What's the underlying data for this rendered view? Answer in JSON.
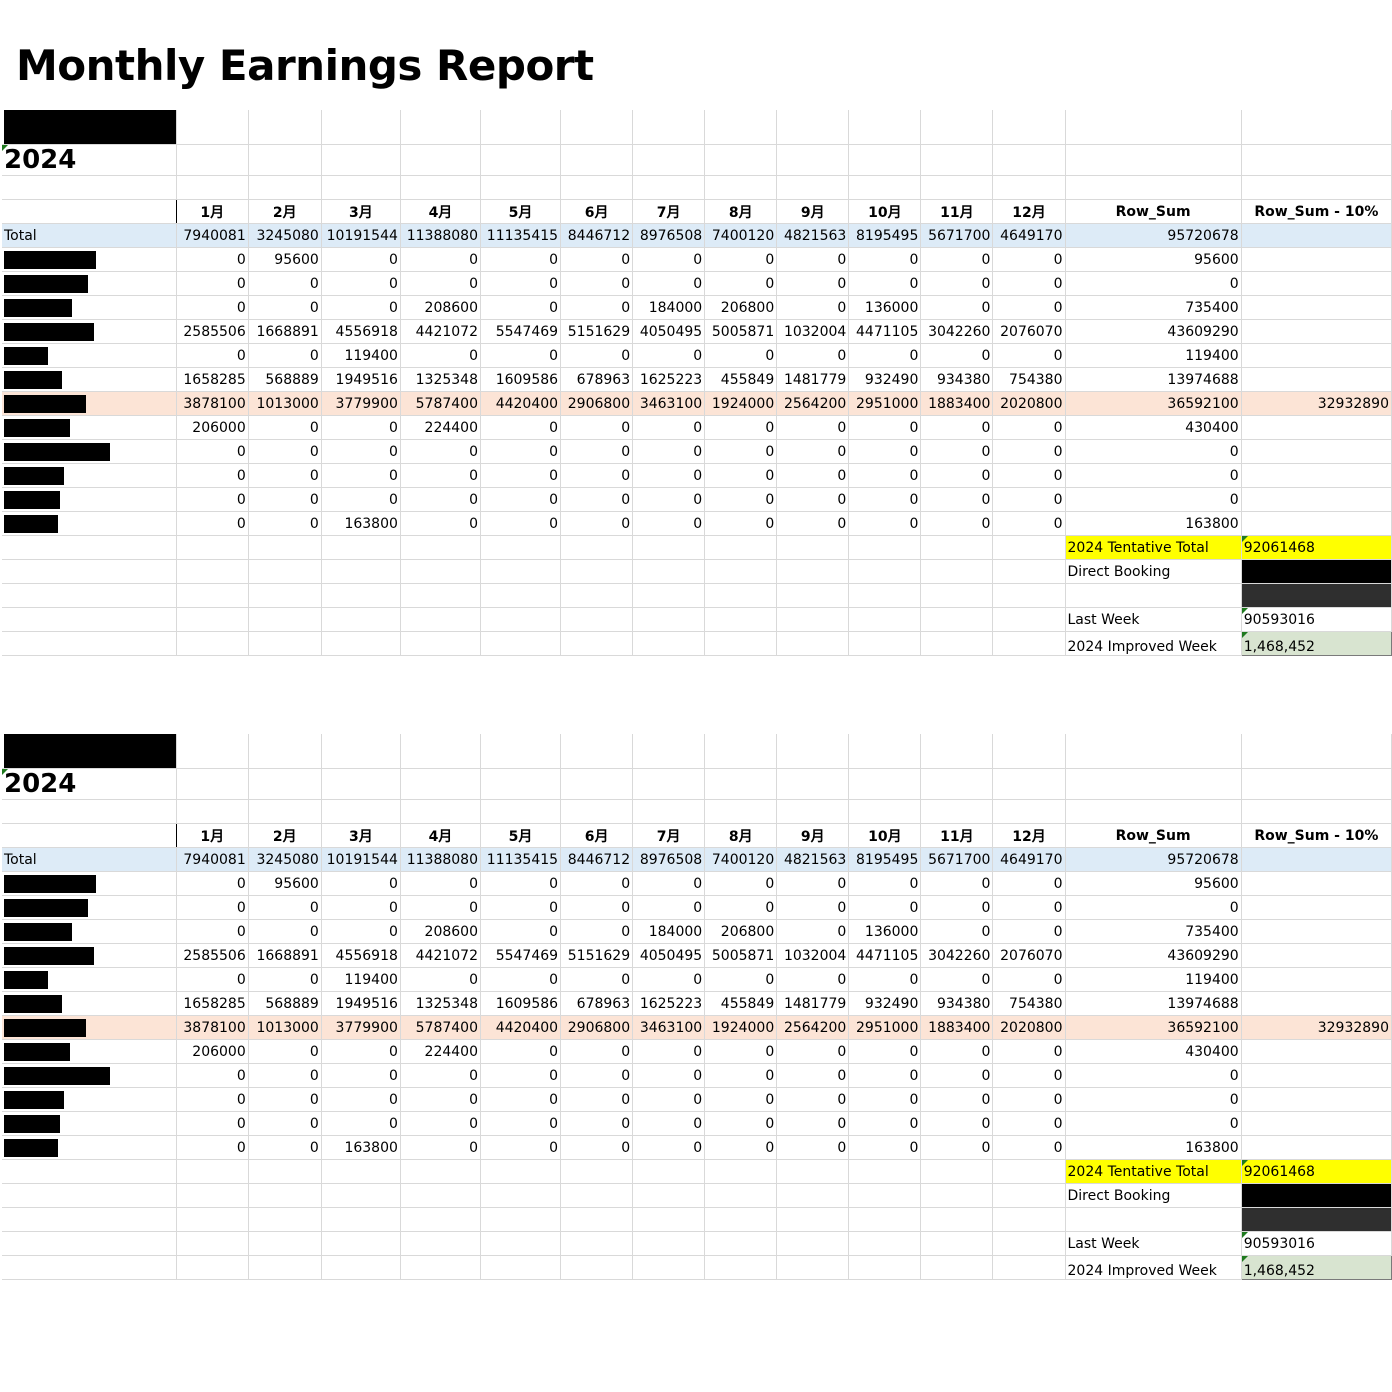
{
  "page_title": "Monthly Earnings Report",
  "sheets": [
    {
      "year": "2024",
      "headers": [
        "1月",
        "2月",
        "3月",
        "4月",
        "5月",
        "6月",
        "7月",
        "8月",
        "9月",
        "10月",
        "11月",
        "12月",
        "Row_Sum",
        "Row_Sum - 10%"
      ],
      "total_label": "Total",
      "total": [
        "7940081",
        "3245080",
        "10191544",
        "11388080",
        "11135415",
        "8446712",
        "8976508",
        "7400120",
        "4821563",
        "8195495",
        "5671700",
        "4649170",
        "95720678",
        ""
      ],
      "rows": [
        [
          "0",
          "95600",
          "0",
          "0",
          "0",
          "0",
          "0",
          "0",
          "0",
          "0",
          "0",
          "0",
          "95600",
          ""
        ],
        [
          "0",
          "0",
          "0",
          "0",
          "0",
          "0",
          "0",
          "0",
          "0",
          "0",
          "0",
          "0",
          "0",
          ""
        ],
        [
          "0",
          "0",
          "0",
          "208600",
          "0",
          "0",
          "184000",
          "206800",
          "0",
          "136000",
          "0",
          "0",
          "735400",
          ""
        ],
        [
          "2585506",
          "1668891",
          "4556918",
          "4421072",
          "5547469",
          "5151629",
          "4050495",
          "5005871",
          "1032004",
          "4471105",
          "3042260",
          "2076070",
          "43609290",
          ""
        ],
        [
          "0",
          "0",
          "119400",
          "0",
          "0",
          "0",
          "0",
          "0",
          "0",
          "0",
          "0",
          "0",
          "119400",
          ""
        ],
        [
          "1658285",
          "568889",
          "1949516",
          "1325348",
          "1609586",
          "678963",
          "1625223",
          "455849",
          "1481779",
          "932490",
          "934380",
          "754380",
          "13974688",
          ""
        ],
        [
          "3878100",
          "1013000",
          "3779900",
          "5787400",
          "4420400",
          "2906800",
          "3463100",
          "1924000",
          "2564200",
          "2951000",
          "1883400",
          "2020800",
          "36592100",
          "32932890"
        ],
        [
          "206000",
          "0",
          "0",
          "224400",
          "0",
          "0",
          "0",
          "0",
          "0",
          "0",
          "0",
          "0",
          "430400",
          ""
        ],
        [
          "0",
          "0",
          "0",
          "0",
          "0",
          "0",
          "0",
          "0",
          "0",
          "0",
          "0",
          "0",
          "0",
          ""
        ],
        [
          "0",
          "0",
          "0",
          "0",
          "0",
          "0",
          "0",
          "0",
          "0",
          "0",
          "0",
          "0",
          "0",
          ""
        ],
        [
          "0",
          "0",
          "0",
          "0",
          "0",
          "0",
          "0",
          "0",
          "0",
          "0",
          "0",
          "0",
          "0",
          ""
        ],
        [
          "0",
          "0",
          "163800",
          "0",
          "0",
          "0",
          "0",
          "0",
          "0",
          "0",
          "0",
          "0",
          "163800",
          ""
        ]
      ],
      "summary": {
        "tentative_label": "2024 Tentative Total",
        "tentative_value": "92061468",
        "direct_label": "Direct Booking",
        "last_week_label": "Last Week",
        "last_week_value": "90593016",
        "improved_label": "2024 Improved Week",
        "improved_value": "1,468,452"
      }
    },
    {
      "year": "2024",
      "headers": [
        "1月",
        "2月",
        "3月",
        "4月",
        "5月",
        "6月",
        "7月",
        "8月",
        "9月",
        "10月",
        "11月",
        "12月",
        "Row_Sum",
        "Row_Sum - 10%"
      ],
      "total_label": "Total",
      "total": [
        "7940081",
        "3245080",
        "10191544",
        "11388080",
        "11135415",
        "8446712",
        "8976508",
        "7400120",
        "4821563",
        "8195495",
        "5671700",
        "4649170",
        "95720678",
        ""
      ],
      "rows": [
        [
          "0",
          "95600",
          "0",
          "0",
          "0",
          "0",
          "0",
          "0",
          "0",
          "0",
          "0",
          "0",
          "95600",
          ""
        ],
        [
          "0",
          "0",
          "0",
          "0",
          "0",
          "0",
          "0",
          "0",
          "0",
          "0",
          "0",
          "0",
          "0",
          ""
        ],
        [
          "0",
          "0",
          "0",
          "208600",
          "0",
          "0",
          "184000",
          "206800",
          "0",
          "136000",
          "0",
          "0",
          "735400",
          ""
        ],
        [
          "2585506",
          "1668891",
          "4556918",
          "4421072",
          "5547469",
          "5151629",
          "4050495",
          "5005871",
          "1032004",
          "4471105",
          "3042260",
          "2076070",
          "43609290",
          ""
        ],
        [
          "0",
          "0",
          "119400",
          "0",
          "0",
          "0",
          "0",
          "0",
          "0",
          "0",
          "0",
          "0",
          "119400",
          ""
        ],
        [
          "1658285",
          "568889",
          "1949516",
          "1325348",
          "1609586",
          "678963",
          "1625223",
          "455849",
          "1481779",
          "932490",
          "934380",
          "754380",
          "13974688",
          ""
        ],
        [
          "3878100",
          "1013000",
          "3779900",
          "5787400",
          "4420400",
          "2906800",
          "3463100",
          "1924000",
          "2564200",
          "2951000",
          "1883400",
          "2020800",
          "36592100",
          "32932890"
        ],
        [
          "206000",
          "0",
          "0",
          "224400",
          "0",
          "0",
          "0",
          "0",
          "0",
          "0",
          "0",
          "0",
          "430400",
          ""
        ],
        [
          "0",
          "0",
          "0",
          "0",
          "0",
          "0",
          "0",
          "0",
          "0",
          "0",
          "0",
          "0",
          "0",
          ""
        ],
        [
          "0",
          "0",
          "0",
          "0",
          "0",
          "0",
          "0",
          "0",
          "0",
          "0",
          "0",
          "0",
          "0",
          ""
        ],
        [
          "0",
          "0",
          "0",
          "0",
          "0",
          "0",
          "0",
          "0",
          "0",
          "0",
          "0",
          "0",
          "0",
          ""
        ],
        [
          "0",
          "0",
          "163800",
          "0",
          "0",
          "0",
          "0",
          "0",
          "0",
          "0",
          "0",
          "0",
          "163800",
          ""
        ]
      ],
      "summary": {
        "tentative_label": "2024 Tentative Total",
        "tentative_value": "92061468",
        "direct_label": "Direct Booking",
        "last_week_label": "Last Week",
        "last_week_value": "90593016",
        "improved_label": "2024 Improved Week",
        "improved_value": "1,468,452"
      }
    }
  ],
  "colors": {
    "total_row": "#ddebf7",
    "highlight_row": "#fce4d6",
    "tentative_highlight": "#ffff00",
    "improved_cell": "#d8e4d0",
    "redaction": "#000000"
  }
}
